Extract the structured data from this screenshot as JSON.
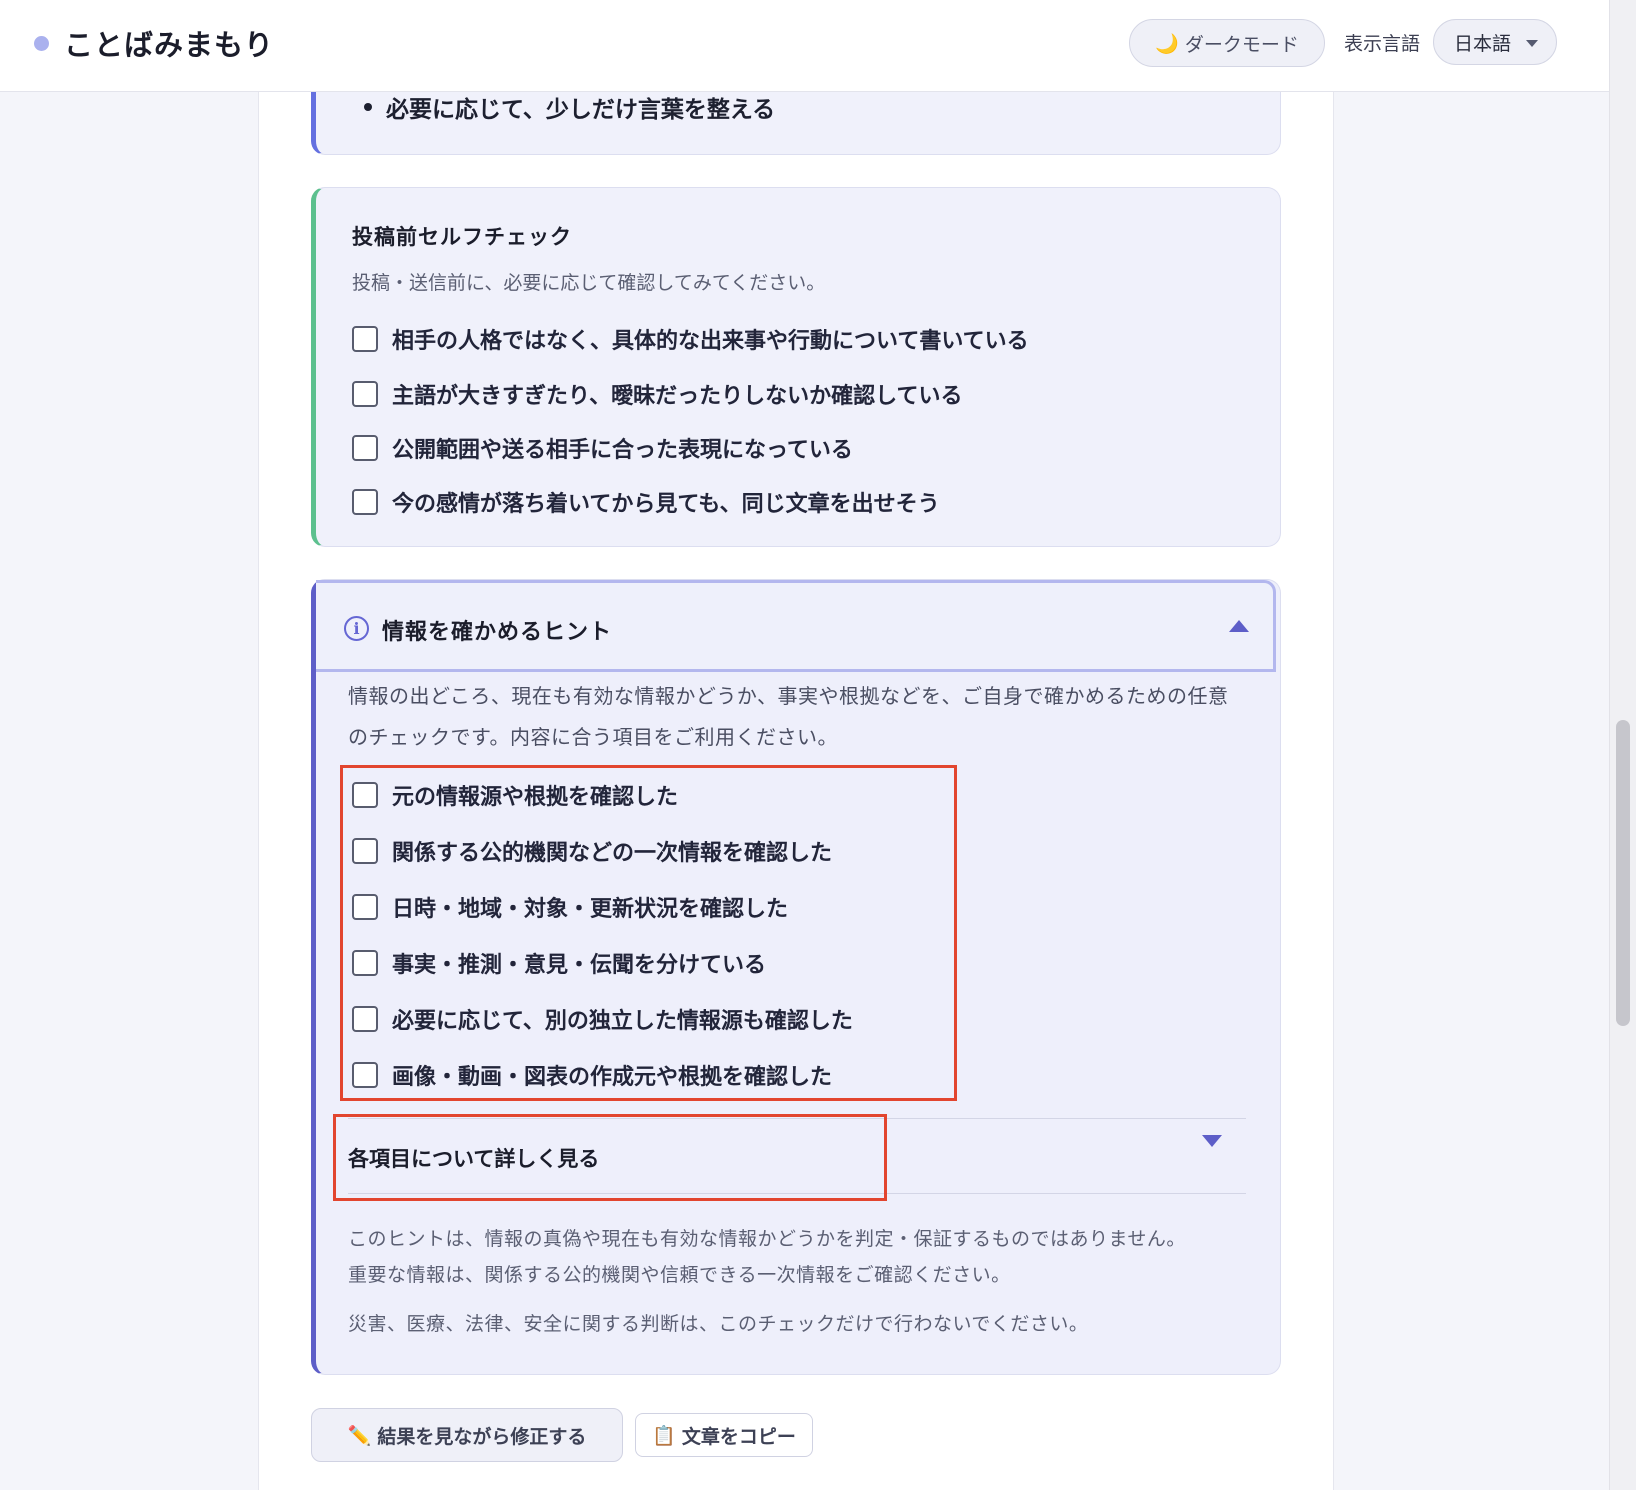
{
  "header": {
    "app_name": "ことばみまもり",
    "dark_mode_icon": "🌙",
    "dark_mode_label": "ダークモード",
    "language_label": "表示言語",
    "language_value": "日本語"
  },
  "top_card": {
    "bullet": "必要に応じて、少しだけ言葉を整える"
  },
  "self_check": {
    "title": "投稿前セルフチェック",
    "subtitle": "投稿・送信前に、必要に応じて確認してみてください。",
    "items": [
      "相手の人格ではなく、具体的な出来事や行動について書いている",
      "主語が大きすぎたり、曖昧だったりしないか確認している",
      "公開範囲や送る相手に合った表現になっている",
      "今の感情が落ち着いてから見ても、同じ文章を出せそう"
    ]
  },
  "hint": {
    "icon_glyph": "i",
    "title": "情報を確かめるヒント",
    "description": "情報の出どころ、現在も有効な情報かどうか、事実や根拠などを、ご自身で確かめるための任意のチェックです。内容に合う項目をご利用ください。",
    "items": [
      "元の情報源や根拠を確認した",
      "関係する公的機関などの一次情報を確認した",
      "日時・地域・対象・更新状況を確認した",
      "事実・推測・意見・伝聞を分けている",
      "必要に応じて、別の独立した情報源も確認した",
      "画像・動画・図表の作成元や根拠を確認した"
    ],
    "details_label": "各項目について詳しく見る",
    "note_1": "このヒントは、情報の真偽や現在も有効な情報かどうかを判定・保証するものではありません。",
    "note_2": "重要な情報は、関係する公的機関や信頼できる一次情報をご確認ください。",
    "note_3": "災害、医療、法律、安全に関する判断は、このチェックだけで行わないでください。"
  },
  "actions": {
    "edit_icon": "✏️",
    "edit_label": "結果を見ながら修正する",
    "copy_icon": "📋",
    "copy_label": "文章をコピー"
  },
  "colors": {
    "accent": "#5d5ec8",
    "self_check_border": "#5cc08e",
    "highlight": "#e2452f"
  }
}
